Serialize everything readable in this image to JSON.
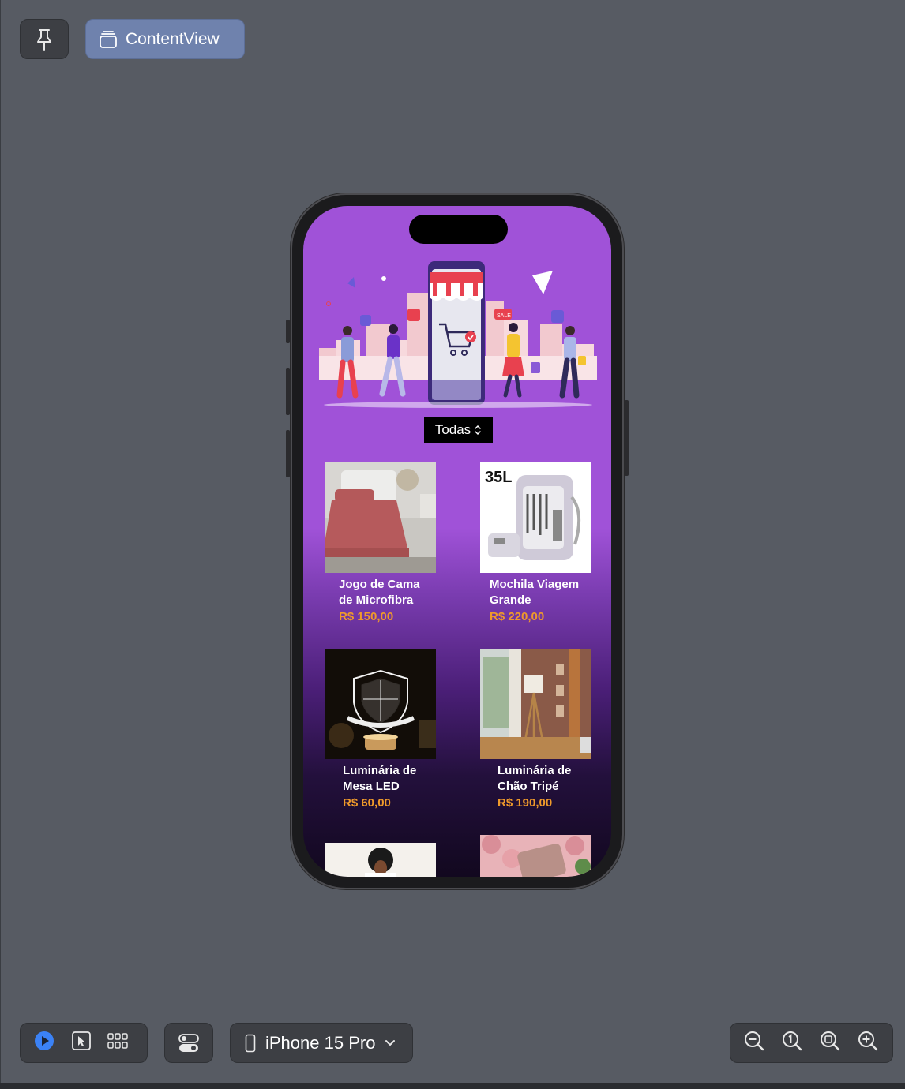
{
  "toolbar": {
    "preview_title": "ContentView"
  },
  "app": {
    "picker_label": "Todas",
    "products": [
      {
        "name_line1": "Jogo de Cama",
        "name_line2": "de Microfibra",
        "price": "R$ 150,00"
      },
      {
        "name_line1": "Mochila Viagem",
        "name_line2": "Grande",
        "price": "R$ 220,00",
        "image_text": "35L"
      },
      {
        "name_line1": "Luminária de",
        "name_line2": "Mesa LED",
        "price": "R$ 60,00"
      },
      {
        "name_line1": "Luminária de",
        "name_line2": "Chão Tripé",
        "price": "R$ 190,00"
      }
    ]
  },
  "bottom_bar": {
    "device": "iPhone 15 Pro"
  },
  "colors": {
    "canvas": "#575b63",
    "screen_purple": "#a052d8",
    "price_orange": "#ef9a2b",
    "play_blue": "#3b82f6"
  }
}
